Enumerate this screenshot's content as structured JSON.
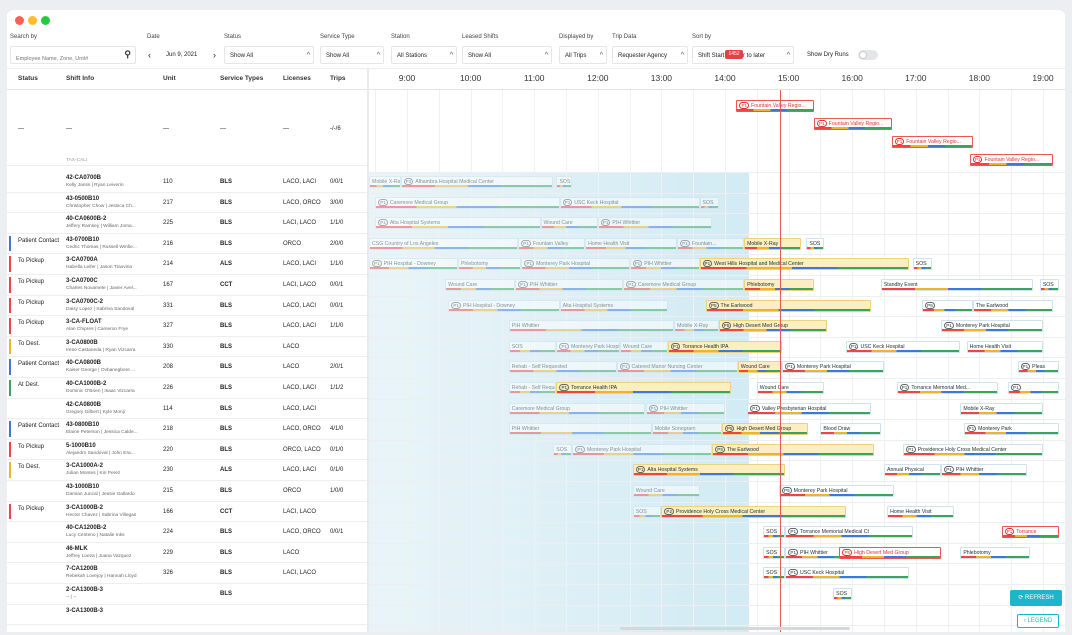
{
  "filters": {
    "search": {
      "label": "Search by",
      "placeholder": "Employee Name, Zone, Unit#"
    },
    "date": {
      "label": "Date",
      "value": "Jun 9, 2021",
      "prev": "‹",
      "next": "›"
    },
    "status": {
      "label": "Status",
      "value": "Show All"
    },
    "service_type": {
      "label": "Service Type",
      "value": "Show All"
    },
    "station": {
      "label": "Station",
      "value": "All Stations"
    },
    "leased_shifts": {
      "label": "Leased Shifts",
      "value": "Show All"
    },
    "displayed_by": {
      "label": "Displayed by",
      "value": "All Trips"
    },
    "trip_data": {
      "label": "Trip Data",
      "value": "Requester Agency"
    },
    "sort_by": {
      "label": "Sort by",
      "value": "Shift Start: Earlier to later"
    },
    "dry_runs_label": "Show Dry Runs",
    "caret_up": "^"
  },
  "columns": [
    "Status",
    "Shift Info",
    "Unit",
    "Service Types",
    "Licenses",
    "Trips"
  ],
  "hours": [
    "9:00",
    "10:00",
    "11:00",
    "12:00",
    "13:00",
    "14:00",
    "15:00",
    "16:00",
    "17:00",
    "18:00",
    "19:00"
  ],
  "now_tag": "1452",
  "summary_row": {
    "status": "—",
    "shift": "—",
    "unit": "—",
    "service": "—",
    "license": "—",
    "trips": "-/-/6",
    "cutoff": "TAX-CALI"
  },
  "rows": [
    {
      "status": "",
      "color": "",
      "shift": "42-CA0700B",
      "crew": "Kelly Janss | Ryan Leiverin",
      "unit": "110",
      "service": "BLS",
      "license": "LACO, LACI",
      "trips": "0/0/1"
    },
    {
      "status": "",
      "color": "",
      "shift": "43-0500B10",
      "crew": "Christopher Chow | Jessica Ch...",
      "unit": "217",
      "service": "BLS",
      "license": "LACO, ORCO",
      "trips": "3/0/0"
    },
    {
      "status": "",
      "color": "",
      "shift": "40-CA0600B-2",
      "crew": "Jeffery Ramsey | William Joma...",
      "unit": "225",
      "service": "BLS",
      "license": "LACI, LACO",
      "trips": "1/1/0"
    },
    {
      "status": "Patient Contact",
      "color": "#3d78d8",
      "shift": "43-0700B10",
      "crew": "Cedric Thomas | Russell Winfie...",
      "unit": "216",
      "service": "BLS",
      "license": "ORCO",
      "trips": "2/0/0"
    },
    {
      "status": "To Pickup",
      "color": "#e44",
      "shift": "3-CA0700A",
      "crew": "Isabella Leifer | Jason Traxvina",
      "unit": "214",
      "service": "ALS",
      "license": "LACO, LACI",
      "trips": "1/1/0"
    },
    {
      "status": "To Pickup",
      "color": "#e44",
      "shift": "3-CA0700C",
      "crew": "Charles Novamete | Javier Avel...",
      "unit": "167",
      "service": "CCT",
      "license": "LACI, LACO",
      "trips": "0/0/1"
    },
    {
      "status": "To Pickup",
      "color": "#e44",
      "shift": "3-CA0700C-2",
      "crew": "Daisy Lopez | Sabrina Sandoval",
      "unit": "331",
      "service": "BLS",
      "license": "LACO, LACI",
      "trips": "0/0/1"
    },
    {
      "status": "To Pickup",
      "color": "#e44",
      "shift": "3-CA-FLOAT",
      "crew": "Alan Chipres | Cameron Frye",
      "unit": "327",
      "service": "BLS",
      "license": "LACO, LACI",
      "trips": "1/1/0"
    },
    {
      "status": "To Dest.",
      "color": "#f0b42c",
      "shift": "3-CA0800B",
      "crew": "Irene Castaneda | Ryan Vizcarra",
      "unit": "330",
      "service": "BLS",
      "license": "LACO",
      "trips": ""
    },
    {
      "status": "Patient Contact",
      "color": "#3d78d8",
      "shift": "40-CA0800B",
      "crew": "Kaiser George | Ovbanegbere ...",
      "unit": "208",
      "service": "BLS",
      "license": "LACO",
      "trips": "2/0/1"
    },
    {
      "status": "At Dest.",
      "color": "#3aa55a",
      "shift": "40-CA1000B-2",
      "crew": "Dominic O'Brien | Isaac Vizcarra",
      "unit": "226",
      "service": "BLS",
      "license": "LACO, LACI",
      "trips": "1/1/2"
    },
    {
      "status": "",
      "color": "",
      "shift": "42-CA0800B",
      "crew": "Gregory Gilbert | Kyle Monji",
      "unit": "114",
      "service": "BLS",
      "license": "LACO, LACI",
      "trips": ""
    },
    {
      "status": "Patient Contact",
      "color": "#3d78d8",
      "shift": "43-0800B10",
      "crew": "Elaine Peterson | Jessica Calde...",
      "unit": "218",
      "service": "BLS",
      "license": "LACO, ORCO",
      "trips": "4/1/0"
    },
    {
      "status": "To Pickup",
      "color": "#e44",
      "shift": "5-1000B10",
      "crew": "Alejandro Sandoval | John Era...",
      "unit": "220",
      "service": "BLS",
      "license": "ORCO, LACO",
      "trips": "0/1/0"
    },
    {
      "status": "To Dest.",
      "color": "#f0b42c",
      "shift": "3-CA1000A-2",
      "crew": "Julian Montes | Kiri Perez",
      "unit": "230",
      "service": "ALS",
      "license": "LACO, LACI",
      "trips": "0/1/0"
    },
    {
      "status": "",
      "color": "",
      "shift": "43-1000B10",
      "crew": "Damian Juncal | Jessie Gallardo",
      "unit": "215",
      "service": "BLS",
      "license": "ORCO",
      "trips": "1/0/0"
    },
    {
      "status": "To Pickup",
      "color": "#e44",
      "shift": "3-CA1000B-2",
      "crew": "Hector Chavez | Sabrina Villegas",
      "unit": "166",
      "service": "CCT",
      "license": "LACI, LACO",
      "trips": ""
    },
    {
      "status": "",
      "color": "",
      "shift": "40-CA1200B-2",
      "crew": "Lucy Centeno | Natalie Inks",
      "unit": "224",
      "service": "BLS",
      "license": "LACO, ORCO",
      "trips": "0/0/1"
    },
    {
      "status": "",
      "color": "",
      "shift": "46-MLK",
      "crew": "Jeffrey Loeza | Juana Vazquez",
      "unit": "229",
      "service": "BLS",
      "license": "LACO",
      "trips": ""
    },
    {
      "status": "",
      "color": "",
      "shift": "7-CA1200B",
      "crew": "Rebekah Lovejoy | Hannah Lloyd",
      "unit": "326",
      "service": "BLS",
      "license": "LACI, LACO",
      "trips": ""
    },
    {
      "status": "",
      "color": "",
      "shift": "2-CA1300B-3",
      "crew": "-- | --",
      "unit": "",
      "service": "BLS",
      "license": "",
      "trips": ""
    },
    {
      "status": "",
      "color": "",
      "shift": "3-CA1300B-3",
      "crew": "",
      "unit": "",
      "service": "",
      "license": "",
      "trips": ""
    }
  ],
  "trips": [
    {
      "row": -4,
      "start": 14.18,
      "end": 15.4,
      "p": "P1",
      "label": "Fountain Valley Regio...",
      "kind": "r"
    },
    {
      "row": -3,
      "start": 15.4,
      "end": 16.62,
      "p": "P1",
      "label": "Fountain Valley Regio...",
      "kind": "r"
    },
    {
      "row": -2,
      "start": 16.62,
      "end": 17.9,
      "p": "P1",
      "label": "Fountain Valley Regio...",
      "kind": "r"
    },
    {
      "row": -1,
      "start": 17.85,
      "end": 19.15,
      "p": "P1",
      "label": "Fountain Valley Regio...",
      "kind": "r"
    },
    {
      "row": 0,
      "start": 8.28,
      "end": 8.9,
      "p": "",
      "label": "Mobile X-Ray",
      "kind": "f"
    },
    {
      "row": 0,
      "start": 8.9,
      "end": 11.3,
      "p": "P3",
      "label": "Alhambra Hospital Medical Center",
      "kind": "f"
    },
    {
      "row": 0,
      "start": 11.35,
      "end": 11.6,
      "p": "",
      "label": "SOS",
      "kind": "f"
    },
    {
      "row": 1,
      "start": 8.5,
      "end": 11.4,
      "p": "P1",
      "label": "Caremore Medical Group",
      "kind": "f"
    },
    {
      "row": 1,
      "start": 11.4,
      "end": 13.6,
      "p": "P1",
      "label": "USC Keck Hospital",
      "kind": "f"
    },
    {
      "row": 1,
      "start": 13.6,
      "end": 13.9,
      "p": "",
      "label": "SOS",
      "kind": "f"
    },
    {
      "row": 2,
      "start": 8.5,
      "end": 11.1,
      "p": "P1",
      "label": "Alta Hospital Systems",
      "kind": "f"
    },
    {
      "row": 2,
      "start": 11.1,
      "end": 12.0,
      "p": "",
      "label": "Wound Care",
      "kind": "f"
    },
    {
      "row": 2,
      "start": 12.0,
      "end": 13.8,
      "p": "P1",
      "label": "PIH Whittier",
      "kind": "f"
    },
    {
      "row": 3,
      "start": 8.25,
      "end": 10.75,
      "p": "",
      "label": "CSG Country of Los Angeles",
      "kind": "f"
    },
    {
      "row": 3,
      "start": 10.75,
      "end": 11.8,
      "p": "P1",
      "label": "Fountain Valley",
      "kind": "f"
    },
    {
      "row": 3,
      "start": 11.8,
      "end": 13.25,
      "p": "",
      "label": "Home Health Visit",
      "kind": "f"
    },
    {
      "row": 3,
      "start": 13.25,
      "end": 14.3,
      "p": "P1",
      "label": "Fountain...",
      "kind": "f"
    },
    {
      "row": 3,
      "start": 14.3,
      "end": 15.2,
      "p": "",
      "label": "Mobile X-Ray",
      "kind": "y"
    },
    {
      "row": 3,
      "start": 15.28,
      "end": 15.55,
      "p": "",
      "label": "SOS",
      "kind": ""
    },
    {
      "row": 4,
      "start": 8.25,
      "end": 9.8,
      "p": "P1",
      "label": "PIH Hospital - Downey",
      "kind": "f"
    },
    {
      "row": 4,
      "start": 9.8,
      "end": 10.8,
      "p": "",
      "label": "Phlebotomy",
      "kind": "f"
    },
    {
      "row": 4,
      "start": 10.8,
      "end": 12.5,
      "p": "P1",
      "label": "Monterey Park Hospital",
      "kind": "f"
    },
    {
      "row": 4,
      "start": 12.5,
      "end": 13.6,
      "p": "P1",
      "label": "PIH Whittier",
      "kind": "f"
    },
    {
      "row": 4,
      "start": 13.6,
      "end": 16.9,
      "p": "P1",
      "label": "West Hills Hospital and Medical Center",
      "kind": "y"
    },
    {
      "row": 4,
      "start": 16.95,
      "end": 17.25,
      "p": "",
      "label": "SOS",
      "kind": ""
    },
    {
      "row": 5,
      "start": 9.6,
      "end": 10.7,
      "p": "",
      "label": "Wound Care",
      "kind": "f"
    },
    {
      "row": 5,
      "start": 10.7,
      "end": 12.4,
      "p": "P1",
      "label": "PIH Whittier",
      "kind": "f"
    },
    {
      "row": 5,
      "start": 12.4,
      "end": 14.3,
      "p": "P1",
      "label": "Caremore Medical Group",
      "kind": "f"
    },
    {
      "row": 5,
      "start": 14.3,
      "end": 15.4,
      "p": "",
      "label": "Phlebotomy",
      "kind": "y"
    },
    {
      "row": 5,
      "start": 16.45,
      "end": 18.85,
      "p": "",
      "label": "Standby Event",
      "kind": ""
    },
    {
      "row": 5,
      "start": 18.95,
      "end": 19.25,
      "p": "",
      "label": "SOS",
      "kind": ""
    },
    {
      "row": 6,
      "start": 9.65,
      "end": 11.4,
      "p": "P1",
      "label": "PIH Hospital - Downey",
      "kind": "f"
    },
    {
      "row": 6,
      "start": 11.4,
      "end": 13.1,
      "p": "",
      "label": "Alta Hospital Systems",
      "kind": "f"
    },
    {
      "row": 6,
      "start": 13.7,
      "end": 16.3,
      "p": "P5",
      "label": "The Earlwood",
      "kind": "y"
    },
    {
      "row": 6,
      "start": 17.1,
      "end": 17.9,
      "p": "P5",
      "label": "",
      "kind": ""
    },
    {
      "row": 6,
      "start": 17.9,
      "end": 19.15,
      "p": "",
      "label": "The Earlwood",
      "kind": ""
    },
    {
      "row": 7,
      "start": 10.6,
      "end": 13.2,
      "p": "",
      "label": "PIH Whittier",
      "kind": "f"
    },
    {
      "row": 7,
      "start": 13.2,
      "end": 13.9,
      "p": "",
      "label": "Mobile X-Ray",
      "kind": "f"
    },
    {
      "row": 7,
      "start": 13.9,
      "end": 15.6,
      "p": "P5",
      "label": "High Desert Med Group",
      "kind": "y"
    },
    {
      "row": 7,
      "start": 17.4,
      "end": 19.0,
      "p": "P1",
      "label": "Monterey Park Hospital",
      "kind": ""
    },
    {
      "row": 8,
      "start": 10.6,
      "end": 11.35,
      "p": "",
      "label": "SOS",
      "kind": "f"
    },
    {
      "row": 8,
      "start": 11.35,
      "end": 12.35,
      "p": "P1",
      "label": "Monterey Park Hospital",
      "kind": "f"
    },
    {
      "row": 8,
      "start": 12.35,
      "end": 13.1,
      "p": "",
      "label": "Wound Care",
      "kind": "f"
    },
    {
      "row": 8,
      "start": 13.1,
      "end": 14.9,
      "p": "P1",
      "label": "Torrance Health IPA",
      "kind": "y"
    },
    {
      "row": 8,
      "start": 15.9,
      "end": 17.7,
      "p": "P1",
      "label": "USC Keck Hospital",
      "kind": ""
    },
    {
      "row": 8,
      "start": 17.8,
      "end": 19.0,
      "p": "",
      "label": "Home Health Visit",
      "kind": ""
    },
    {
      "row": 9,
      "start": 10.6,
      "end": 12.3,
      "p": "",
      "label": "Rehab - Self Requested",
      "kind": "f"
    },
    {
      "row": 9,
      "start": 12.3,
      "end": 14.2,
      "p": "P1",
      "label": "Catered Manor Nursing Center",
      "kind": "f"
    },
    {
      "row": 9,
      "start": 14.2,
      "end": 14.9,
      "p": "",
      "label": "Wound Care",
      "kind": "y"
    },
    {
      "row": 9,
      "start": 14.9,
      "end": 16.5,
      "p": "P1",
      "label": "Monterey Park Hospital",
      "kind": ""
    },
    {
      "row": 9,
      "start": 18.6,
      "end": 19.25,
      "p": "P1",
      "label": "Pleas",
      "kind": ""
    },
    {
      "row": 10,
      "start": 10.6,
      "end": 11.35,
      "p": "",
      "label": "Rehab - Self Requested",
      "kind": "f"
    },
    {
      "row": 10,
      "start": 11.35,
      "end": 14.1,
      "p": "P1",
      "label": "Torrance Health IPA",
      "kind": "y"
    },
    {
      "row": 10,
      "start": 14.5,
      "end": 15.55,
      "p": "",
      "label": "Wound Care",
      "kind": ""
    },
    {
      "row": 10,
      "start": 16.7,
      "end": 18.3,
      "p": "P1",
      "label": "Torrance Memorial Med...",
      "kind": ""
    },
    {
      "row": 10,
      "start": 18.45,
      "end": 19.25,
      "p": "P1",
      "label": "",
      "kind": ""
    },
    {
      "row": 11,
      "start": 10.6,
      "end": 12.75,
      "p": "",
      "label": "Caremore Medical Group",
      "kind": "f"
    },
    {
      "row": 11,
      "start": 12.75,
      "end": 14.0,
      "p": "P1",
      "label": "PIH Whittier",
      "kind": "f"
    },
    {
      "row": 11,
      "start": 14.35,
      "end": 16.3,
      "p": "P1",
      "label": "Valley Presbyterian Hospital",
      "kind": ""
    },
    {
      "row": 11,
      "start": 17.7,
      "end": 19.0,
      "p": "",
      "label": "Mobile X-Ray",
      "kind": ""
    },
    {
      "row": 12,
      "start": 10.6,
      "end": 12.85,
      "p": "",
      "label": "PIH Whittier",
      "kind": "f"
    },
    {
      "row": 12,
      "start": 12.85,
      "end": 13.95,
      "p": "",
      "label": "Mobile Sonogram",
      "kind": "f"
    },
    {
      "row": 12,
      "start": 13.95,
      "end": 15.3,
      "p": "P5",
      "label": "High Desert Med Group",
      "kind": "y"
    },
    {
      "row": 12,
      "start": 15.5,
      "end": 16.45,
      "p": "",
      "label": "Blood Draw",
      "kind": ""
    },
    {
      "row": 12,
      "start": 17.75,
      "end": 19.25,
      "p": "P1",
      "label": "Monterey Park",
      "kind": ""
    },
    {
      "row": 13,
      "start": 11.3,
      "end": 11.6,
      "p": "",
      "label": "SOS",
      "kind": "f"
    },
    {
      "row": 13,
      "start": 11.6,
      "end": 13.8,
      "p": "P1",
      "label": "Monterey Park Hospital",
      "kind": "f"
    },
    {
      "row": 13,
      "start": 13.8,
      "end": 16.35,
      "p": "P5",
      "label": "The Earlwood",
      "kind": "y"
    },
    {
      "row": 13,
      "start": 16.8,
      "end": 19.0,
      "p": "P1",
      "label": "Providence Holy Cross Medical Center",
      "kind": ""
    },
    {
      "row": 14,
      "start": 12.55,
      "end": 14.95,
      "p": "P1",
      "label": "Alta Hospital Systems",
      "kind": "y"
    },
    {
      "row": 14,
      "start": 16.5,
      "end": 17.4,
      "p": "",
      "label": "Annual Physical",
      "kind": ""
    },
    {
      "row": 14,
      "start": 17.4,
      "end": 18.75,
      "p": "P1",
      "label": "PIH Whittier",
      "kind": ""
    },
    {
      "row": 15,
      "start": 12.55,
      "end": 13.6,
      "p": "",
      "label": "Wound Care",
      "kind": "f"
    },
    {
      "row": 15,
      "start": 14.85,
      "end": 16.65,
      "p": "P5",
      "label": "Monterey Park Hospital",
      "kind": ""
    },
    {
      "row": 16,
      "start": 12.55,
      "end": 13.0,
      "p": "",
      "label": "SOS",
      "kind": "f"
    },
    {
      "row": 16,
      "start": 13.0,
      "end": 15.9,
      "p": "P2",
      "label": "Providence Holy Cross Medical Center",
      "kind": "y"
    },
    {
      "row": 16,
      "start": 16.55,
      "end": 17.6,
      "p": "",
      "label": "Home Health Visit",
      "kind": ""
    },
    {
      "row": 17,
      "start": 14.6,
      "end": 14.95,
      "p": "",
      "label": "SOS",
      "kind": ""
    },
    {
      "row": 17,
      "start": 14.95,
      "end": 16.95,
      "p": "P1",
      "label": "Torrance Memorial Medical Ct",
      "kind": ""
    },
    {
      "row": 17,
      "start": 18.35,
      "end": 19.25,
      "p": "P1",
      "label": "Torrance",
      "kind": "r"
    },
    {
      "row": 18,
      "start": 14.6,
      "end": 14.95,
      "p": "",
      "label": "SOS",
      "kind": ""
    },
    {
      "row": 18,
      "start": 14.95,
      "end": 16.1,
      "p": "P1",
      "label": "PIH Whittier",
      "kind": ""
    },
    {
      "row": 18,
      "start": 17.7,
      "end": 18.8,
      "p": "",
      "label": "Phlebotomy",
      "kind": ""
    },
    {
      "row": 19,
      "start": 14.6,
      "end": 14.95,
      "p": "",
      "label": "SOS",
      "kind": ""
    },
    {
      "row": 19,
      "start": 14.95,
      "end": 16.9,
      "p": "P1",
      "label": "USC Keck Hospital",
      "kind": ""
    },
    {
      "row": 20,
      "start": 15.7,
      "end": 16.0,
      "p": "",
      "label": "SOS",
      "kind": ""
    }
  ],
  "extra_trips": [
    {
      "x": 15.8,
      "row": 17,
      "p": "P5",
      "label": "High Desert Med Group",
      "kind": "r"
    }
  ],
  "buttons": {
    "refresh": "⟳ REFRESH",
    "legend": "‹ LEGEND"
  }
}
